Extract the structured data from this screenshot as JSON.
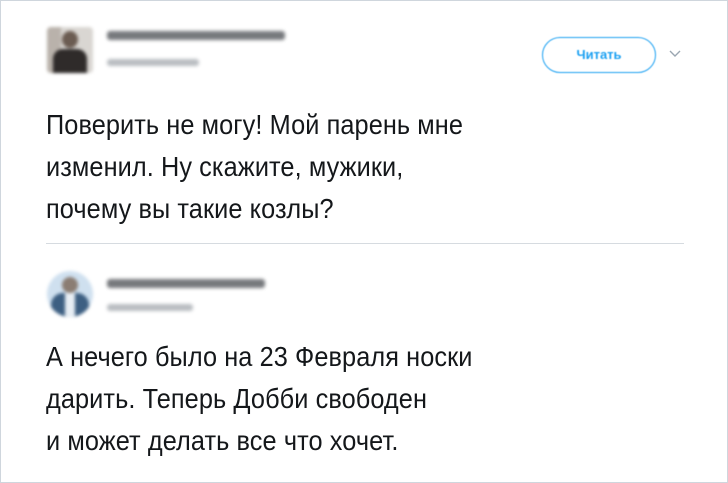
{
  "colors": {
    "accent": "#1da1f2",
    "text": "#14171a",
    "divider": "#d6dbe0"
  },
  "tweet1": {
    "follow_label": "Читать",
    "text_lines": [
      "Поверить не могу! Мой парень мне",
      "изменил. Ну скажите, мужики,",
      "почему вы такие козлы?"
    ]
  },
  "tweet2": {
    "text_lines": [
      "А нечего было на 23 Февраля носки",
      "дарить. Теперь Добби свободен",
      "и может делать все что хочет."
    ]
  },
  "icons": {
    "caret": "chevron-down-icon"
  }
}
